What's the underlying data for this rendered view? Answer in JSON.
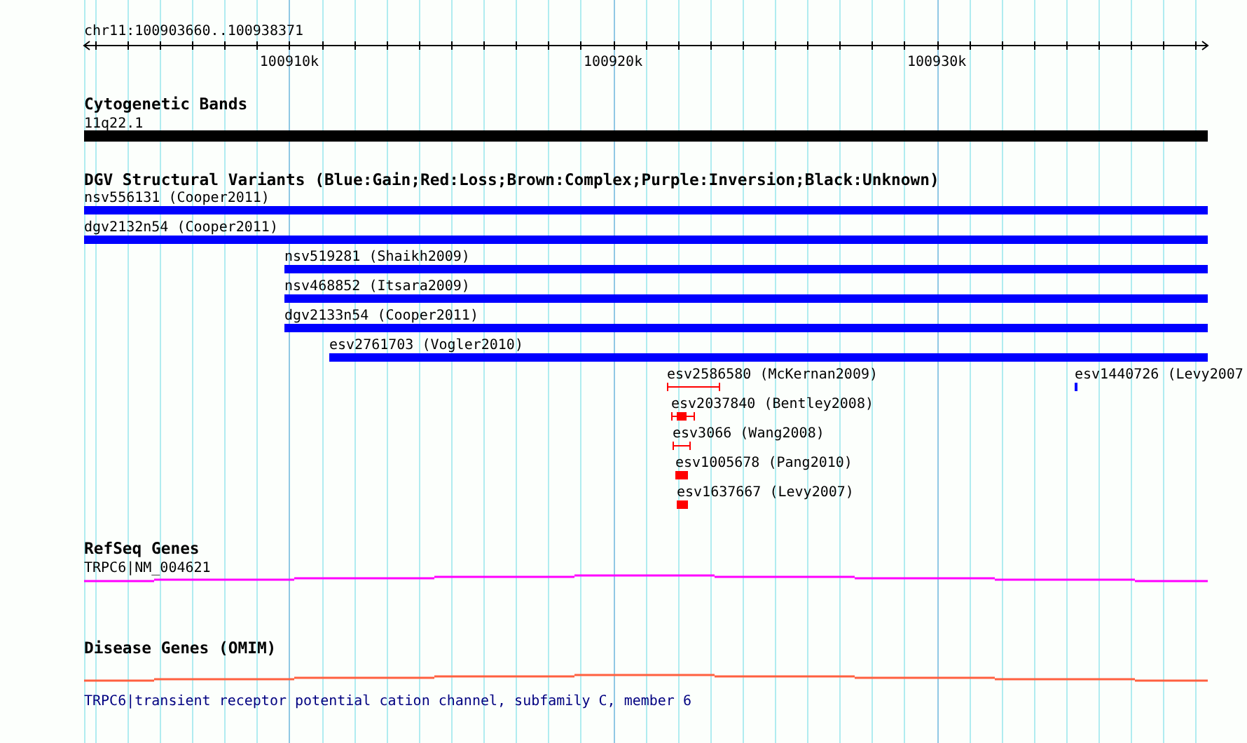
{
  "ruler": {
    "region": "chr11:100903660..100938371",
    "tick_labels": [
      "100910k",
      "100920k",
      "100930k"
    ]
  },
  "tracks": [
    {
      "kind": "cytoband",
      "title": "Cytogenetic Bands",
      "features": [
        {
          "label": "11q22.1"
        }
      ]
    },
    {
      "kind": "variants",
      "title": "DGV Structural Variants (Blue:Gain;Red:Loss;Brown:Complex;Purple:Inversion;Black:Unknown)",
      "rows": [
        [
          {
            "label": "nsv556131 (Cooper2011)",
            "kind": "bar",
            "color": "#0000ff"
          }
        ],
        [
          {
            "label": "dgv2132n54 (Cooper2011)",
            "kind": "bar",
            "color": "#0000ff"
          }
        ],
        [
          {
            "label": "nsv519281 (Shaikh2009)",
            "kind": "bar",
            "color": "#0000ff"
          }
        ],
        [
          {
            "label": "nsv468852 (Itsara2009)",
            "kind": "bar",
            "color": "#0000ff"
          }
        ],
        [
          {
            "label": "dgv2133n54 (Cooper2011)",
            "kind": "bar",
            "color": "#0000ff"
          }
        ],
        [
          {
            "label": "esv2761703 (Vogler2010)",
            "kind": "bar",
            "color": "#0000ff"
          }
        ],
        [
          {
            "label": "esv2586580 (McKernan2009)",
            "kind": "span",
            "color": "#ff0000"
          },
          {
            "label": "esv1440726 (Levy2007",
            "kind": "bar",
            "color": "#0000ff"
          }
        ],
        [
          {
            "label": "esv2037840 (Bentley2008)",
            "kind": "span_core",
            "color": "#ff0000"
          }
        ],
        [
          {
            "label": "esv3066 (Wang2008)",
            "kind": "span",
            "color": "#ff0000"
          }
        ],
        [
          {
            "label": "esv1005678 (Pang2010)",
            "kind": "bar",
            "color": "#ff0000"
          }
        ],
        [
          {
            "label": "esv1637667 (Levy2007)",
            "kind": "bar",
            "color": "#ff0000"
          }
        ]
      ]
    },
    {
      "kind": "gene",
      "title": "RefSeq Genes",
      "features": [
        {
          "label": "TRPC6|NM_004621"
        }
      ]
    },
    {
      "kind": "disease_gene",
      "title": "Disease Genes (OMIM)",
      "features": [
        {
          "label": "TRPC6|transient receptor potential cation channel, subfamily C, member 6"
        }
      ]
    }
  ]
}
